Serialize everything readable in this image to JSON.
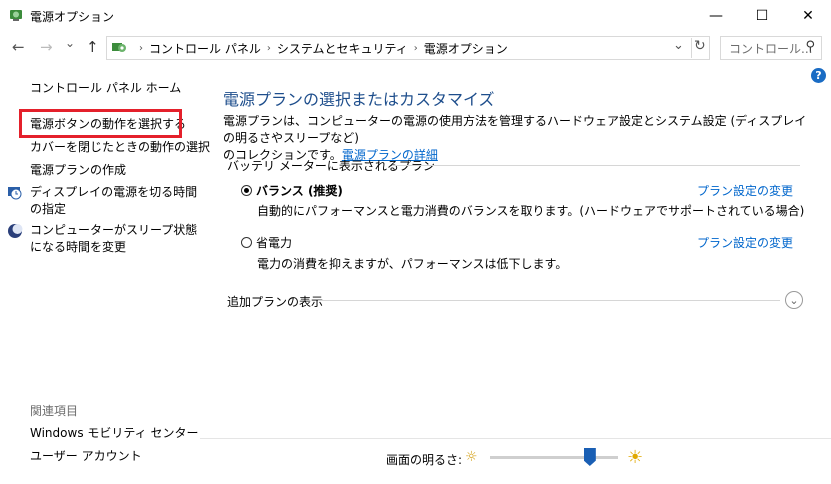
{
  "window": {
    "title": "電源オプション",
    "minimize": "—",
    "maximize": "☐",
    "close": "✕"
  },
  "nav": {
    "back": "←",
    "forward": "→",
    "dropdown": "⌄",
    "up": "↑",
    "breadcrumbs": [
      "コントロール パネル",
      "システムとセキュリティ",
      "電源オプション"
    ],
    "address_dropdown": "⌄",
    "refresh": "↻"
  },
  "search": {
    "placeholder": "コントロール...",
    "icon": "⚲"
  },
  "sidebar": {
    "home": "コントロール パネル ホーム",
    "items": [
      "電源ボタンの動作を選択する",
      "カバーを閉じたときの動作の選択",
      "電源プランの作成",
      "ディスプレイの電源を切る時間の指定",
      "コンピューターがスリープ状態になる時間を変更"
    ],
    "related_header": "関連項目",
    "related": [
      "Windows モビリティ センター",
      "ユーザー アカウント"
    ]
  },
  "main": {
    "title": "電源プランの選択またはカスタマイズ",
    "desc_line1": "電源プランは、コンピューターの電源の使用方法を管理するハードウェア設定とシステム設定 (ディスプレイの明るさやスリープなど)",
    "desc_line2": "のコレクションです。",
    "desc_link": "電源プランの詳細",
    "battery_section": "バッテリ メーターに表示されるプラン",
    "plans": [
      {
        "name": "バランス (推奨)",
        "desc": "自動的にパフォーマンスと電力消費のバランスを取ります。(ハードウェアでサポートされている場合)",
        "link": "プラン設定の変更",
        "selected": true
      },
      {
        "name": "省電力",
        "desc": "電力の消費を抑えますが、パフォーマンスは低下します。",
        "link": "プラン設定の変更",
        "selected": false
      }
    ],
    "additional_plans": "追加プランの表示",
    "expand_icon": "⌄",
    "help": "?"
  },
  "brightness": {
    "label": "画面の明るさ:",
    "value_fraction": 0.78,
    "dim_icon": "☼",
    "bright_icon": "☀"
  }
}
